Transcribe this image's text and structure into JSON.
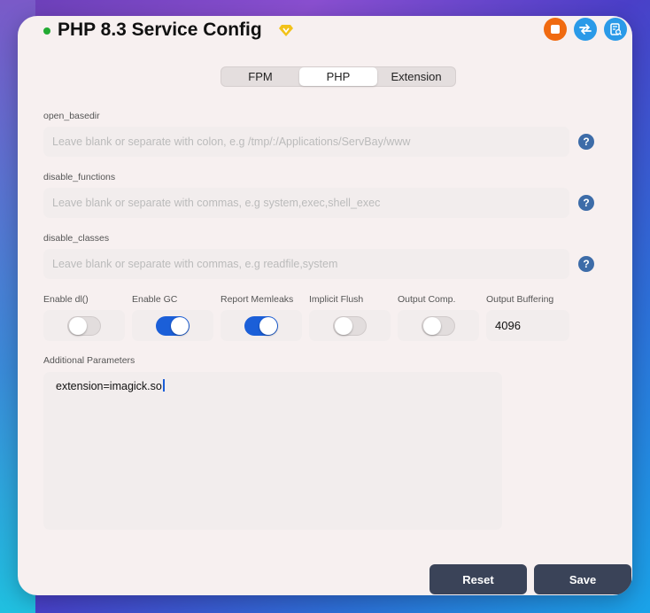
{
  "window": {
    "title": "PHP 8.3 Service Config"
  },
  "tabs": [
    {
      "label": "FPM",
      "active": false
    },
    {
      "label": "PHP",
      "active": true
    },
    {
      "label": "Extension",
      "active": false
    }
  ],
  "fields": {
    "open_basedir": {
      "label": "open_basedir",
      "value": "",
      "placeholder": "Leave blank or separate with colon, e.g /tmp/:/Applications/ServBay/www"
    },
    "disable_functions": {
      "label": "disable_functions",
      "value": "",
      "placeholder": "Leave blank or separate with commas, e.g system,exec,shell_exec"
    },
    "disable_classes": {
      "label": "disable_classes",
      "value": "",
      "placeholder": "Leave blank or separate with commas, e.g readfile,system"
    }
  },
  "toggles": [
    {
      "label": "Enable dl()",
      "on": false
    },
    {
      "label": "Enable GC",
      "on": true
    },
    {
      "label": "Report Memleaks",
      "on": true
    },
    {
      "label": "Implicit Flush",
      "on": false
    },
    {
      "label": "Output Comp.",
      "on": false
    }
  ],
  "output_buffering": {
    "label": "Output Buffering",
    "value": "4096"
  },
  "additional": {
    "label": "Additional Parameters",
    "value": "extension=imagick.so"
  },
  "help_glyph": "?",
  "buttons": {
    "reset": "Reset",
    "save": "Save"
  },
  "colors": {
    "accent": "#1b5fd8",
    "stop": "#f06a10",
    "action": "#2a9ae8",
    "button": "#3a4358",
    "status_ok": "#22aa33"
  }
}
